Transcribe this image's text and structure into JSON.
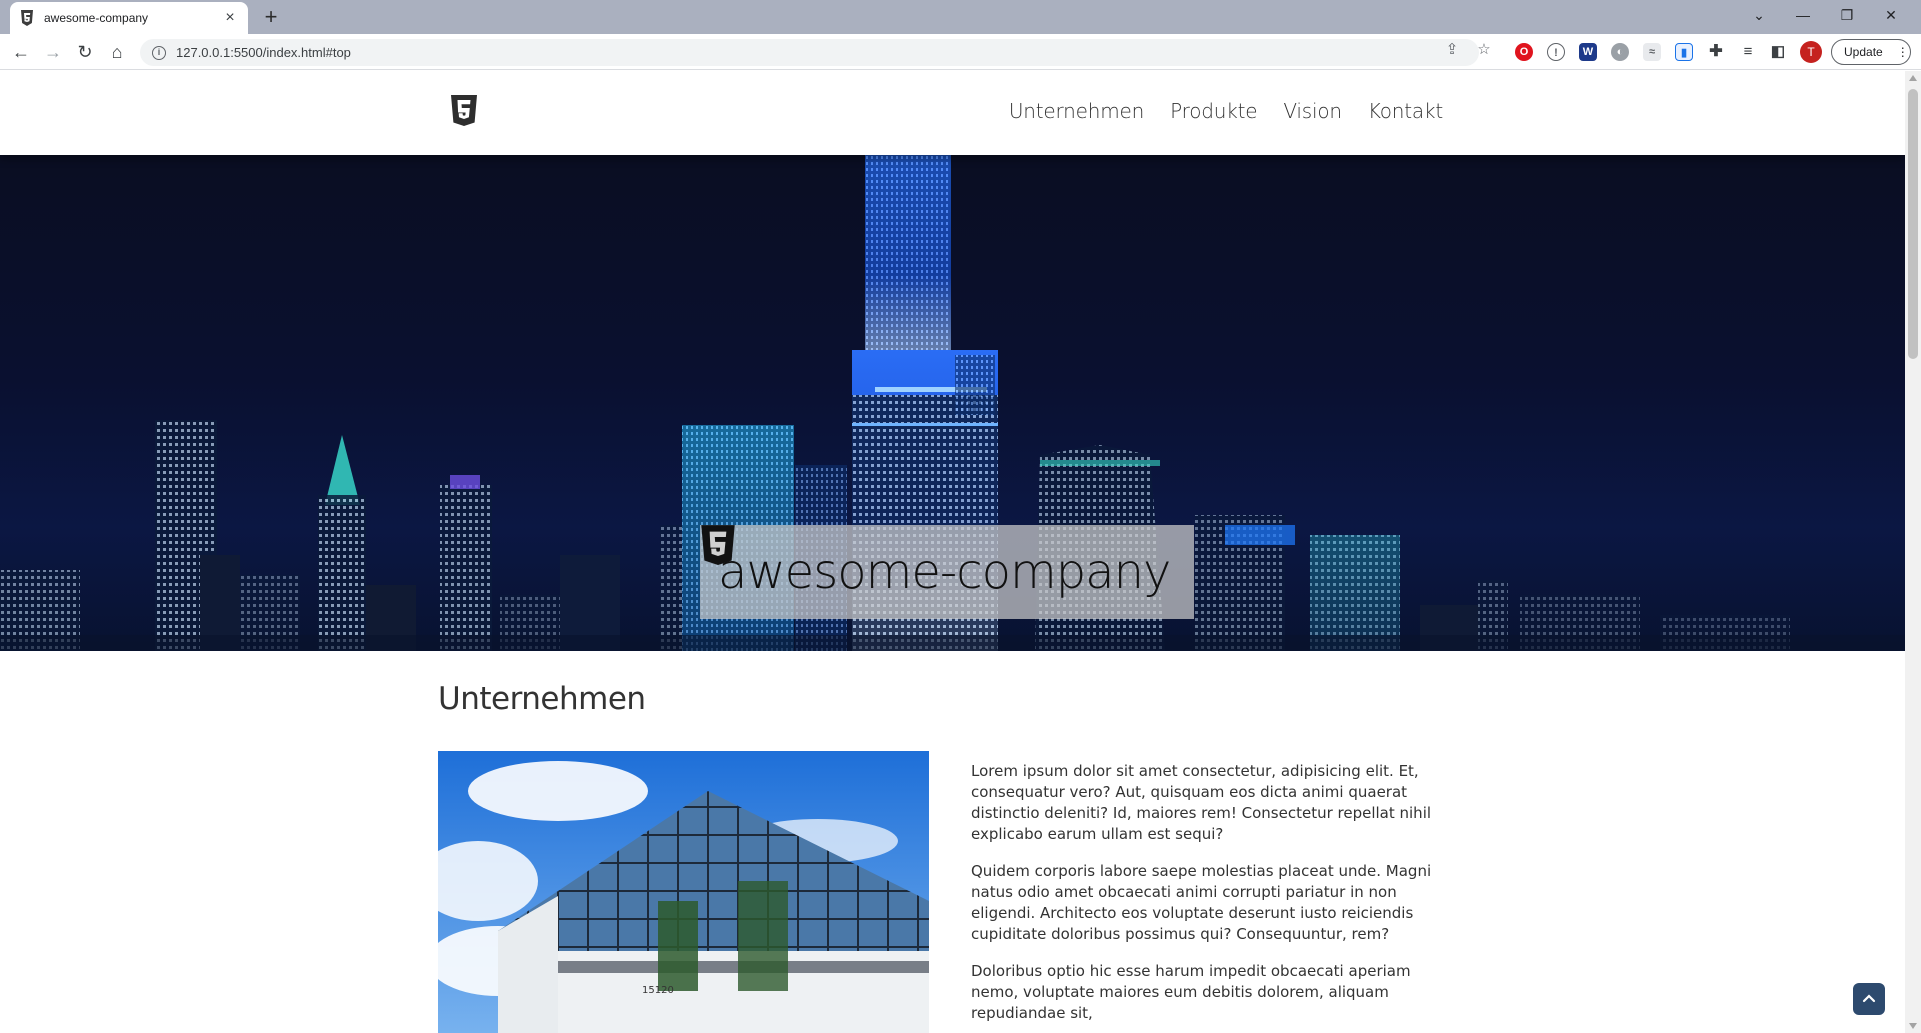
{
  "browser": {
    "tab_title": "awesome-company",
    "tab_close": "×",
    "new_tab": "+",
    "url": "127.0.0.1:5500/index.html#top",
    "update_label": "Update",
    "avatar_letter": "T",
    "icons": [
      "back-arrow-icon",
      "forward-arrow-icon",
      "reload-icon",
      "home-icon",
      "info-icon",
      "share-icon",
      "star-icon",
      "opera-extension-icon",
      "ublock-extension-icon",
      "w-extension-icon",
      "ext-icon",
      "ext-icon-2",
      "ext-icon-3",
      "puzzle-icon",
      "reading-list-icon",
      "sidebar-icon",
      "menu-dots-icon"
    ]
  },
  "site": {
    "nav": [
      "Unternehmen",
      "Produkte",
      "Vision",
      "Kontakt"
    ],
    "hero_title": "awesome-company",
    "section_title": "Unternehmen",
    "paragraphs": [
      "Lorem ipsum dolor sit amet consectetur, adipisicing elit. Et, consequatur vero? Aut, quisquam eos dicta animi quaerat distinctio deleniti? Id, maiores rem! Consectetur repellat nihil explicabo earum ullam est sequi?",
      "Quidem corporis labore saepe molestias placeat unde. Magni natus odio amet obcaecati animi corrupti pariatur in non eligendi. Architecto eos voluptate deserunt iusto reiciendis cupiditate doloribus possimus qui? Consequuntur, rem?",
      "Doloribus optio hic esse harum impedit obcaecati aperiam nemo, voluptate maiores eum debitis dolorem, aliquam repudiandae sit,"
    ],
    "building_number": "15120",
    "colors": {
      "hero_bg": "#0a1030",
      "to_top_button": "#2d4a6e",
      "text": "#333333"
    }
  }
}
